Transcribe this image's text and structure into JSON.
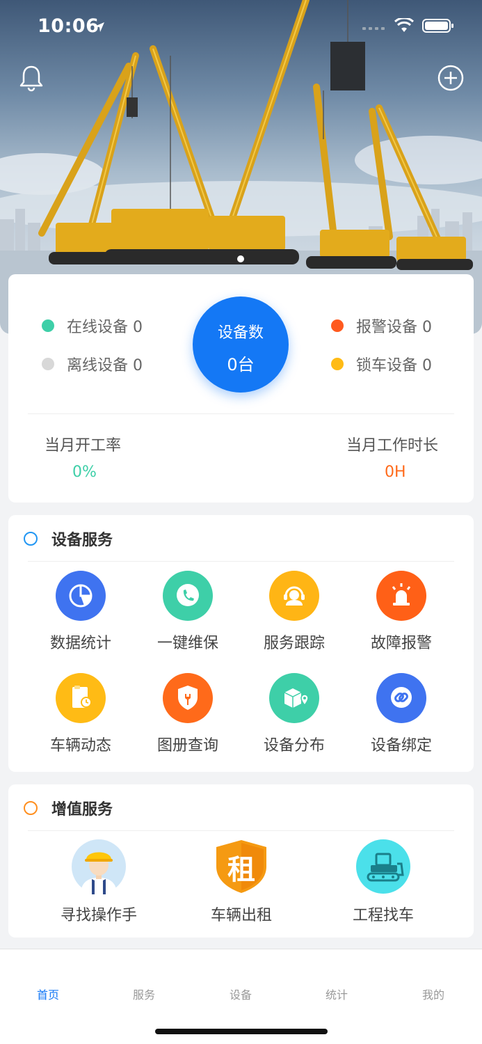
{
  "status_bar": {
    "time": "10:06"
  },
  "summary": {
    "online_label": "在线设备 0",
    "offline_label": "离线设备 0",
    "alarm_label": "报警设备 0",
    "lock_label": "锁车设备 0",
    "center_label": "设备数",
    "center_value": "0台",
    "monthly_rate_label": "当月开工率",
    "monthly_rate_value": "0%",
    "monthly_hours_label": "当月工作时长",
    "monthly_hours_value": "0H",
    "colors": {
      "online": "#3ecfa8",
      "offline": "#d8d8d8",
      "alarm": "#ff5a1f",
      "lock": "#ffbb15",
      "rate": "#3ecfa8",
      "hours": "#ff6a1a",
      "center": "#1478f5"
    }
  },
  "device_service": {
    "title": "设备服务",
    "items": [
      {
        "label": "数据统计",
        "icon": "pie-chart-icon",
        "color": "#3f73f0"
      },
      {
        "label": "一键维保",
        "icon": "phone-icon",
        "color": "#3ecfa8"
      },
      {
        "label": "服务跟踪",
        "icon": "headset-icon",
        "color": "#ffb515"
      },
      {
        "label": "故障报警",
        "icon": "siren-icon",
        "color": "#ff6017"
      },
      {
        "label": "车辆动态",
        "icon": "document-clock-icon",
        "color": "#ffbb15"
      },
      {
        "label": "图册查询",
        "icon": "wrench-shield-icon",
        "color": "#ff6a1a"
      },
      {
        "label": "设备分布",
        "icon": "map-box-icon",
        "color": "#3ecfa8"
      },
      {
        "label": "设备绑定",
        "icon": "link-icon",
        "color": "#3f73f0"
      }
    ]
  },
  "value_service": {
    "title": "增值服务",
    "items": [
      {
        "label": "寻找操作手",
        "icon": "worker-icon"
      },
      {
        "label": "车辆出租",
        "icon": "rent-shield-icon",
        "badge": "租"
      },
      {
        "label": "工程找车",
        "icon": "bulldozer-icon"
      }
    ]
  },
  "tabbar": {
    "tabs": [
      {
        "label": "首页",
        "active": true
      },
      {
        "label": "服务",
        "active": false
      },
      {
        "label": "设备",
        "active": false
      },
      {
        "label": "统计",
        "active": false
      },
      {
        "label": "我的",
        "active": false
      }
    ]
  }
}
